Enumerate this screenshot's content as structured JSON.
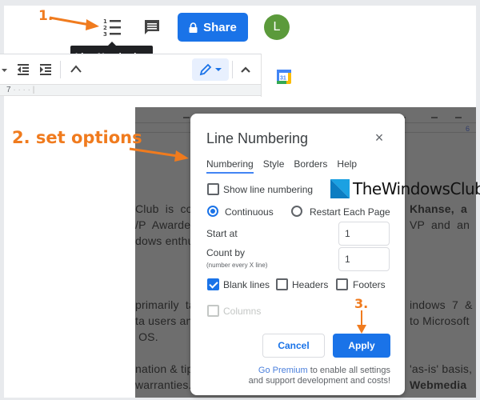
{
  "annotations": {
    "step1": "1.",
    "step2": "2. set options",
    "step3": "3."
  },
  "header": {
    "line_numbering_icon": "line-numbering-icon",
    "comment_icon": "comment-icon",
    "share_label": "Share",
    "avatar_initial": "L",
    "tooltip": "Line Numbering"
  },
  "toolbar": {
    "ruler_mark": "7",
    "icons": [
      "dropdown-arrow-icon",
      "decrease-indent-icon",
      "increase-indent-icon",
      "clear-formatting-icon",
      "editing-mode-icon",
      "collapse-icon",
      "calendar-icon"
    ],
    "calendar_day": "31"
  },
  "document": {
    "ruler_right_mark": "6",
    "left_lines": [
      "Club  is  co",
      "/P  Awarde",
      "dows enthu",
      "primarily  ta",
      "ta users an",
      " OS.",
      "nation & tip",
      "warranties."
    ],
    "right_lines": [
      "Khanse,  a",
      "VP  and  an",
      "indows  7  &",
      "to Microsoft",
      "'as-is' basis,",
      "Webmedia"
    ]
  },
  "dialog": {
    "title": "Line Numbering",
    "close_label": "×",
    "tabs": [
      {
        "label": "Numbering",
        "active": true
      },
      {
        "label": "Style",
        "active": false
      },
      {
        "label": "Borders",
        "active": false
      },
      {
        "label": "Help",
        "active": false
      }
    ],
    "show_line_numbering": {
      "label": "Show line numbering",
      "checked": false
    },
    "mode_options": [
      {
        "label": "Continuous",
        "selected": true
      },
      {
        "label": "Restart Each Page",
        "selected": false
      }
    ],
    "start_at": {
      "label": "Start at",
      "value": "1"
    },
    "count_by": {
      "label": "Count by",
      "hint": "(number every X line)",
      "value": "1"
    },
    "include": [
      {
        "label": "Blank lines",
        "checked": true,
        "disabled": false
      },
      {
        "label": "Headers",
        "checked": false,
        "disabled": false
      },
      {
        "label": "Footers",
        "checked": false,
        "disabled": false
      },
      {
        "label": "Columns",
        "checked": false,
        "disabled": true
      }
    ],
    "cancel_label": "Cancel",
    "apply_label": "Apply",
    "premium_link": "Go Premium",
    "premium_text_1": " to enable all settings",
    "premium_text_2": "and support development and costs!"
  },
  "watermark": {
    "text": "TheWindowsClub"
  },
  "colors": {
    "accent": "#1a73e8",
    "annotation": "#f07b1e",
    "avatar": "#5b9a3b"
  }
}
